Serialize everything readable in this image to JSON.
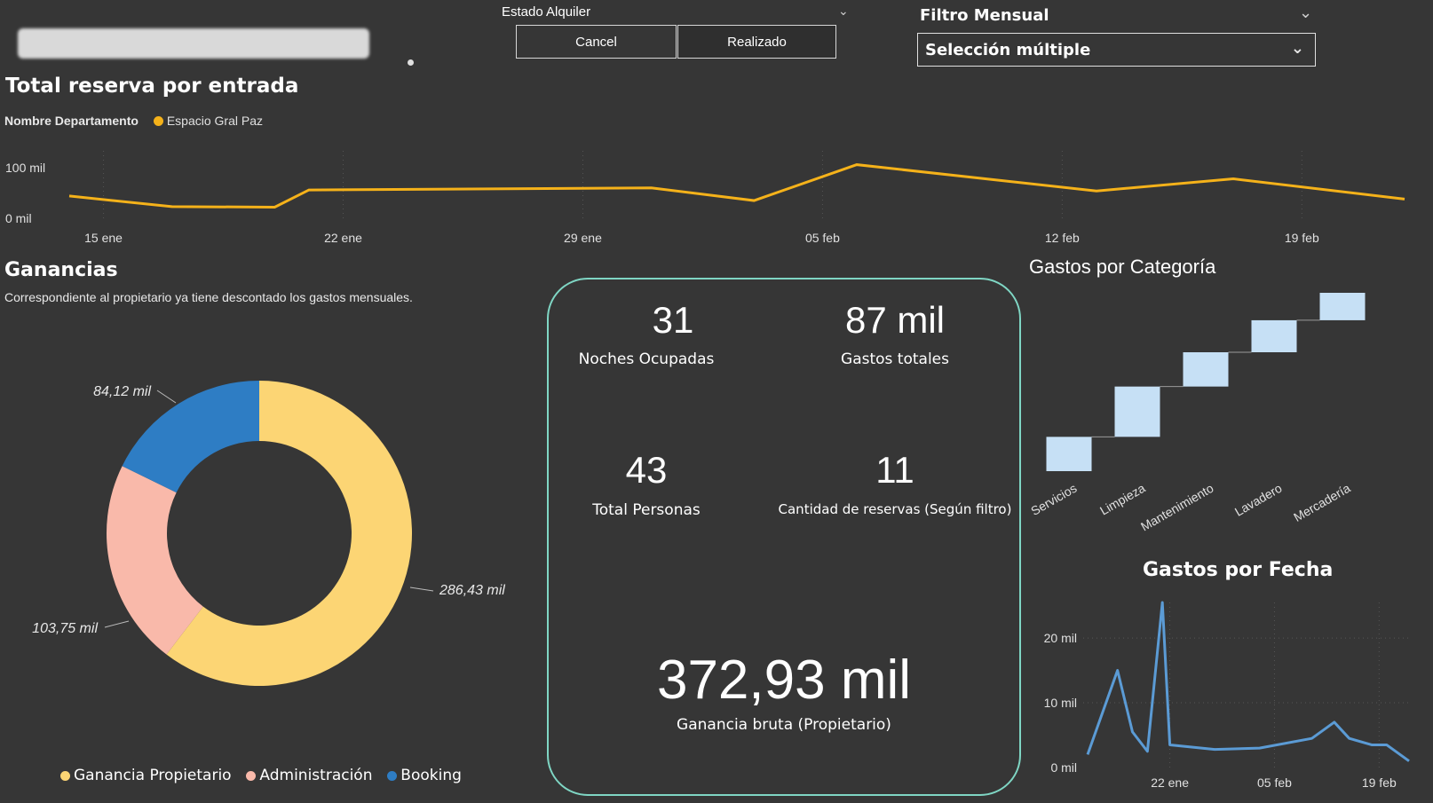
{
  "header": {
    "estado_title": "Estado Alquiler",
    "buttons": [
      {
        "label": "Cancel",
        "selected": false
      },
      {
        "label": "Realizado",
        "selected": true
      }
    ],
    "filtro_title": "Filtro Mensual",
    "filtro_value": "Selección múltiple"
  },
  "reservas": {
    "title": "Total reserva por entrada",
    "legend_label": "Nombre Departamento",
    "legend_item": "Espacio Gral Paz",
    "color": "#f5b21a"
  },
  "ganancias": {
    "title": "Ganancias",
    "subtitle": "Correspondiente al propietario ya tiene descontado los gastos mensuales.",
    "legend": [
      {
        "label": "Ganancia Propietario",
        "color": "#fcd574"
      },
      {
        "label": "Administración",
        "color": "#f9b9aa"
      },
      {
        "label": "Booking",
        "color": "#2e7dc4"
      }
    ]
  },
  "kpis": {
    "noches_value": "31",
    "noches_label": "Noches Ocupadas",
    "gastos_value": "87 mil",
    "gastos_label": "Gastos totales",
    "personas_value": "43",
    "personas_label": "Total Personas",
    "reservas_value": "11",
    "reservas_label": "Cantidad de reservas (Según filtro)",
    "ganancia_value": "372,93 mil",
    "ganancia_label": "Ganancia bruta (Propietario)"
  },
  "gastos_categoria": {
    "title": "Gastos por Categoría"
  },
  "gastos_fecha": {
    "title": "Gastos por Fecha"
  },
  "chart_data": [
    {
      "type": "line",
      "title": "Total reserva por entrada",
      "series": [
        {
          "name": "Espacio Gral Paz",
          "points": [
            [
              "2023-01-14",
              44000
            ],
            [
              "2023-01-17",
              23000
            ],
            [
              "2023-01-20",
              22000
            ],
            [
              "2023-01-21",
              56000
            ],
            [
              "2023-01-31",
              60000
            ],
            [
              "2023-02-03",
              35000
            ],
            [
              "2023-02-06",
              106000
            ],
            [
              "2023-02-13",
              54000
            ],
            [
              "2023-02-17",
              78000
            ],
            [
              "2023-02-22",
              38000
            ]
          ]
        }
      ],
      "x_ticks": [
        "15 ene",
        "22 ene",
        "29 ene",
        "05 feb",
        "12 feb",
        "19 feb"
      ],
      "x_tick_dates": [
        "2023-01-15",
        "2023-01-22",
        "2023-01-29",
        "2023-02-05",
        "2023-02-12",
        "2023-02-19"
      ],
      "xlim": [
        "2023-01-14",
        "2023-02-22"
      ],
      "y_ticks": [
        "0 mil",
        "100 mil"
      ],
      "y_tick_values": [
        0,
        100000
      ],
      "ylim": [
        0,
        100000
      ],
      "grid": "vertical dotted"
    },
    {
      "type": "pie",
      "subtype": "donut",
      "title": "Ganancias",
      "slices": [
        {
          "label": "Ganancia Propietario",
          "value": 286.43,
          "display": "286,43 mil",
          "color": "#fcd574"
        },
        {
          "label": "Administración",
          "value": 103.75,
          "display": "103,75 mil",
          "color": "#f9b9aa"
        },
        {
          "label": "Booking",
          "value": 84.12,
          "display": "84,12 mil",
          "color": "#2e7dc4"
        }
      ],
      "legend_position": "bottom"
    },
    {
      "type": "bar",
      "subtype": "waterfall",
      "title": "Gastos por Categoría",
      "categories": [
        "Servicios",
        "Limpieza",
        "Mantenimiento",
        "Lavadero",
        "Mercadería"
      ],
      "values": [
        7500,
        11000,
        7500,
        7000,
        6000
      ],
      "color": "#c6e0f5"
    },
    {
      "type": "line",
      "title": "Gastos por Fecha",
      "series": [
        {
          "name": "",
          "points": [
            [
              "2023-01-11",
              2000
            ],
            [
              "2023-01-15",
              15000
            ],
            [
              "2023-01-17",
              5500
            ],
            [
              "2023-01-19",
              2500
            ],
            [
              "2023-01-21",
              25500
            ],
            [
              "2023-01-22",
              3500
            ],
            [
              "2023-01-28",
              2800
            ],
            [
              "2023-02-03",
              3000
            ],
            [
              "2023-02-10",
              4500
            ],
            [
              "2023-02-13",
              7000
            ],
            [
              "2023-02-15",
              4500
            ],
            [
              "2023-02-18",
              3500
            ],
            [
              "2023-02-20",
              3500
            ],
            [
              "2023-02-23",
              1000
            ]
          ],
          "color": "#5b9bd5"
        }
      ],
      "x_ticks": [
        "22 ene",
        "05 feb",
        "19 feb"
      ],
      "x_tick_dates": [
        "2023-01-22",
        "2023-02-05",
        "2023-02-19"
      ],
      "xlim": [
        "2023-01-11",
        "2023-02-23"
      ],
      "y_ticks": [
        "0 mil",
        "10 mil",
        "20 mil"
      ],
      "y_tick_values": [
        0,
        10000,
        20000
      ],
      "ylim": [
        0,
        25500
      ],
      "grid": "dotted"
    }
  ]
}
